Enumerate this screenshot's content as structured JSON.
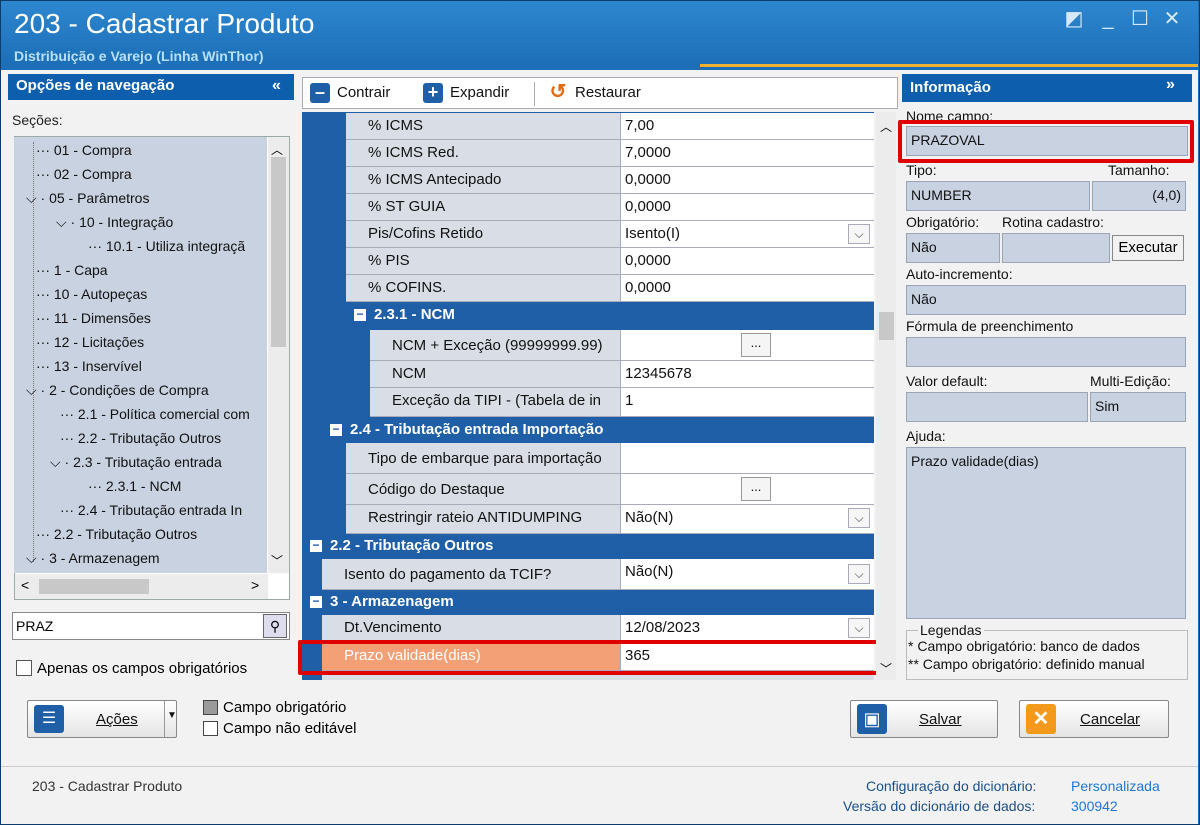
{
  "window": {
    "title": "203 - Cadastrar  Produto",
    "subtitle": "Distribuição e Varejo (Linha WinThor)"
  },
  "nav": {
    "header": "Opções de navegação",
    "collapse": "«",
    "sections_label": "Seções:",
    "tree": [
      "01 - Compra",
      "02 - Compra",
      "05 - Parâmetros",
      "10 - Integração",
      "10.1 - Utiliza integraçã",
      "1 - Capa",
      "10 - Autopeças",
      "11 - Dimensões",
      "12 - Licitações",
      "13 - Inservível",
      "2 - Condições de Compra",
      "2.1 - Política comercial com",
      "2.2 - Tributação Outros",
      "2.3 - Tributação entrada",
      "2.3.1 - NCM",
      "2.4 - Tributação entrada In",
      "2.2 - Tributação Outros",
      "3 - Armazenagem"
    ],
    "search_value": "PRAZ",
    "only_required_label": "Apenas os campos obrigatórios"
  },
  "toolbar": {
    "contrair": "Contrair",
    "expandir": "Expandir",
    "restaurar": "Restaurar"
  },
  "grid": {
    "rows_top": [
      {
        "label": "% ICMS",
        "value": "7,00"
      },
      {
        "label": "% ICMS Red.",
        "value": "7,0000"
      },
      {
        "label": "% ICMS Antecipado",
        "value": "0,0000"
      },
      {
        "label": "% ST GUIA",
        "value": "0,0000"
      },
      {
        "label": "Pis/Cofins Retido",
        "value": "Isento(I)"
      },
      {
        "label": "% PIS",
        "value": "0,0000"
      },
      {
        "label": "% COFINS.",
        "value": "0,0000"
      }
    ],
    "sec_ncm": "2.3.1 - NCM",
    "rows_ncm": [
      {
        "label": "NCM + Exceção (99999999.99)",
        "value": ""
      },
      {
        "label": "NCM",
        "value": "12345678"
      },
      {
        "label": "Exceção da TIPI - (Tabela de in",
        "value": "1"
      }
    ],
    "sec_import": "2.4 - Tributação entrada Importação",
    "rows_import": [
      {
        "label": "Tipo de embarque para importação",
        "value": ""
      },
      {
        "label": "Código do Destaque",
        "value": ""
      },
      {
        "label": "Restringir rateio ANTIDUMPING",
        "value": "Não(N)"
      }
    ],
    "sec_outros": "2.2 - Tributação Outros",
    "rows_outros": [
      {
        "label": "Isento do pagamento da TCIF?",
        "value": "Não(N)"
      }
    ],
    "sec_armaz": "3 - Armazenagem",
    "rows_armaz": [
      {
        "label": "Dt.Vencimento",
        "value": "12/08/2023"
      },
      {
        "label": "Prazo validade(dias)",
        "value": "365"
      }
    ],
    "ellipsis": "..."
  },
  "info": {
    "header": "Informação",
    "expand": "»",
    "nome_campo_label": "Nome campo:",
    "nome_campo": "PRAZOVAL",
    "tipo_label": "Tipo:",
    "tipo": "NUMBER",
    "tamanho_label": "Tamanho:",
    "tamanho": "(4,0)",
    "obrigatorio_label": "Obrigatório:",
    "obrigatorio": "Não",
    "rotina_label": "Rotina cadastro:",
    "executar": "Executar",
    "auto_label": "Auto-incremento:",
    "auto": "Não",
    "formula_label": "Fórmula de preenchimento",
    "valor_default_label": "Valor default:",
    "multi_label": "Multi-Edição:",
    "multi": "Sim",
    "ajuda_label": "Ajuda:",
    "ajuda": "Prazo validade(dias)",
    "legendas_label": "Legendas",
    "legenda1": "* Campo obrigatório: banco de dados",
    "legenda2": "** Campo obrigatório: definido manual"
  },
  "bottom": {
    "acoes": "Ações",
    "campo_obrigatorio": "Campo obrigatório",
    "campo_nao_editavel": "Campo não editável",
    "salvar": "Salvar",
    "cancelar": "Cancelar"
  },
  "footer": {
    "routine": "203 - Cadastrar  Produto",
    "config_label": "Configuração do dicionário:",
    "config_value": "Personalizada",
    "version_label": "Versão do dicionário de dados:",
    "version_value": "300942"
  },
  "colors": {
    "accent": "#1f5fa8",
    "highlight": "#f4a076",
    "red_outline": "#e00000"
  }
}
